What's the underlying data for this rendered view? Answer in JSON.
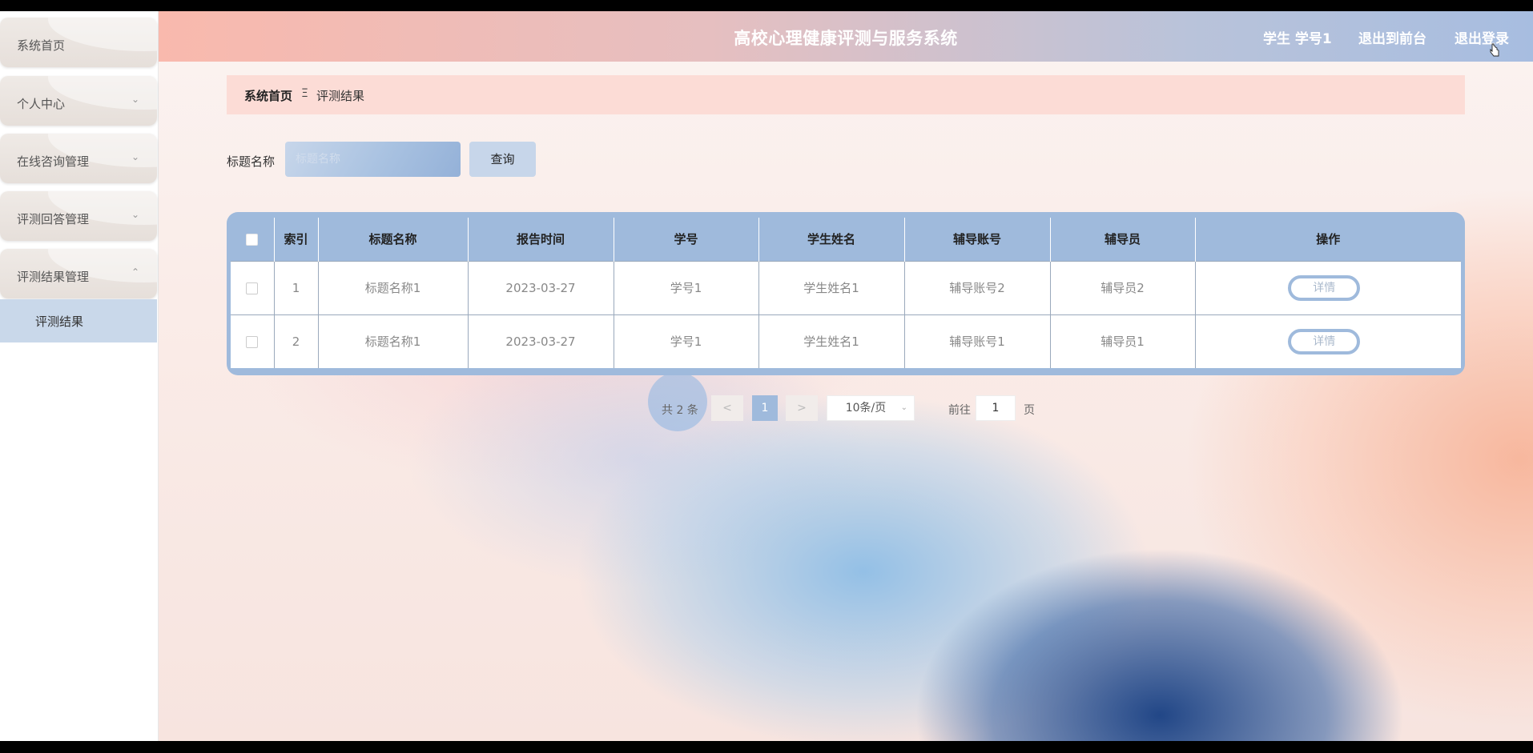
{
  "header": {
    "title": "高校心理健康评测与服务系统",
    "user": "学生 学号1",
    "to_front": "退出到前台",
    "logout": "退出登录"
  },
  "sidebar": {
    "items": [
      {
        "label": "系统首页",
        "chevron": ""
      },
      {
        "label": "个人中心",
        "chevron": "⌄"
      },
      {
        "label": "在线咨询管理",
        "chevron": "⌄"
      },
      {
        "label": "评测回答管理",
        "chevron": "⌄"
      },
      {
        "label": "评测结果管理",
        "chevron": "⌃"
      }
    ],
    "active_sub": "评测结果"
  },
  "breadcrumb": {
    "home": "系统首页",
    "separator": "Ξ",
    "current": "评测结果"
  },
  "search": {
    "label": "标题名称",
    "placeholder": "标题名称",
    "button": "查询"
  },
  "table": {
    "headers": [
      "索引",
      "标题名称",
      "报告时间",
      "学号",
      "学生姓名",
      "辅导账号",
      "辅导员",
      "操作"
    ],
    "rows": [
      {
        "index": "1",
        "title": "标题名称1",
        "time": "2023-03-27",
        "student_no": "学号1",
        "student_name": "学生姓名1",
        "tutor_account": "辅导账号2",
        "tutor": "辅导员2",
        "action": "详情"
      },
      {
        "index": "2",
        "title": "标题名称1",
        "time": "2023-03-27",
        "student_no": "学号1",
        "student_name": "学生姓名1",
        "tutor_account": "辅导账号1",
        "tutor": "辅导员1",
        "action": "详情"
      }
    ]
  },
  "pagination": {
    "total": "共 2 条",
    "prev": "<",
    "current": "1",
    "next": ">",
    "page_size": "10条/页",
    "goto": "前往",
    "jump_value": "1",
    "page_suffix": "页"
  },
  "colors": {
    "accent": "#9fbadc",
    "breadcrumb_bg": "#fcdcd6",
    "header_start": "#f9b9ad",
    "header_end": "#a7bde0"
  }
}
